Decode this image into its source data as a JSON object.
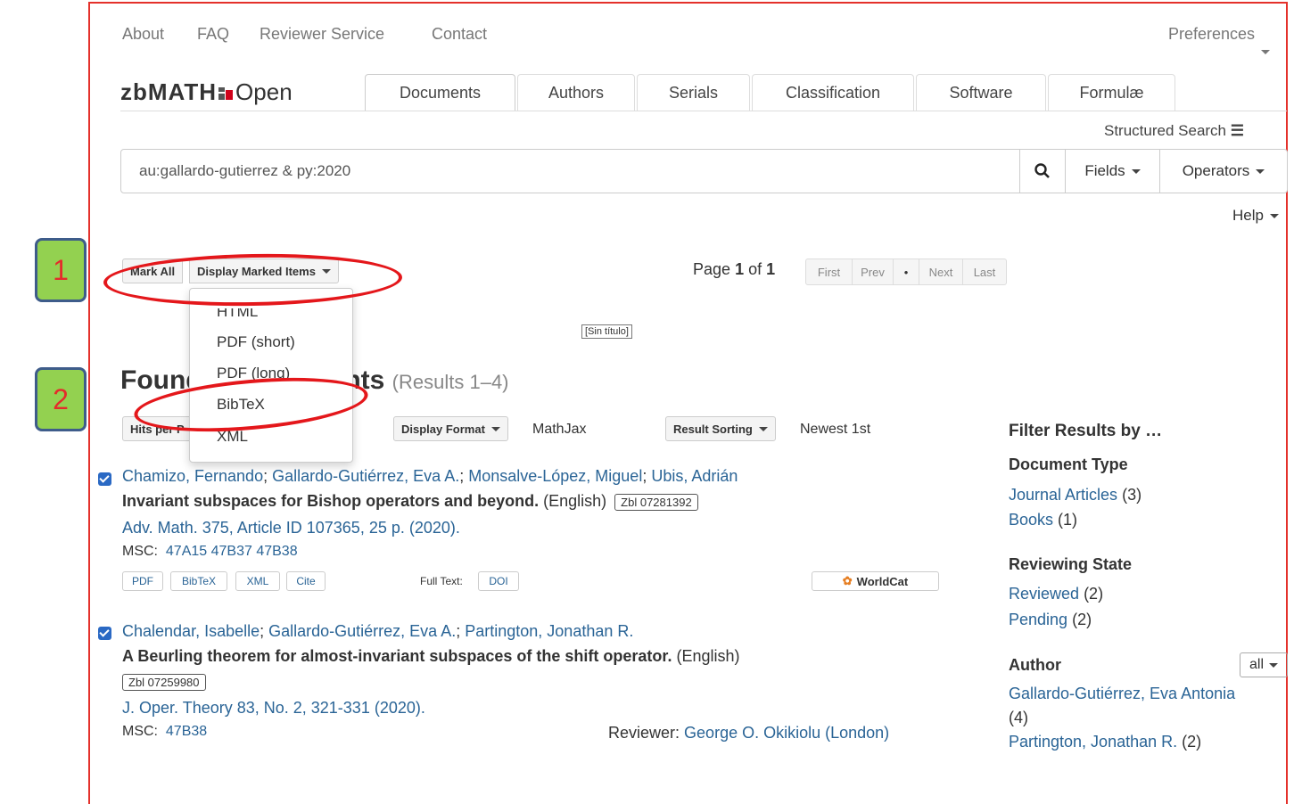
{
  "top_nav": {
    "about": "About",
    "faq": "FAQ",
    "reviewer": "Reviewer Service",
    "contact": "Contact",
    "preferences": "Preferences"
  },
  "logo": {
    "zb": "zbMATH",
    "open": "Open"
  },
  "tabs": [
    "Documents",
    "Authors",
    "Serials",
    "Classification",
    "Software",
    "Formulæ"
  ],
  "structured_search": "Structured Search",
  "search": {
    "value": "au:gallardo-gutierrez & py:2020",
    "fields": "Fields",
    "operators": "Operators"
  },
  "help": "Help",
  "toolbar": {
    "mark_all": "Mark All",
    "display_marked": "Display Marked Items"
  },
  "pager": {
    "page_label": "Page",
    "page": "1",
    "of": "of",
    "total": "1",
    "first": "First",
    "prev": "Prev",
    "dot": "•",
    "next": "Next",
    "last": "Last"
  },
  "tooltip": "[Sin título]",
  "dropdown": [
    "HTML",
    "PDF (short)",
    "PDF (long)",
    "BibTeX",
    "XML"
  ],
  "annotations": {
    "one": "1",
    "two": "2"
  },
  "found": {
    "title_start": "Found",
    "title_end": "ents",
    "results": "(Results 1–4)"
  },
  "controls": {
    "hits_per_page": "Hits per P",
    "display_format": "Display Format",
    "mathjax": "MathJax",
    "result_sorting": "Result Sorting",
    "newest": "Newest 1st"
  },
  "results": [
    {
      "authors": [
        "Chamizo, Fernando",
        "Gallardo-Gutiérrez, Eva A.",
        "Monsalve-López, Miguel",
        "Ubis, Adrián"
      ],
      "title": "Invariant subspaces for Bishop operators and beyond.",
      "lang": "(English)",
      "zbl": "Zbl 07281392",
      "source": "Adv. Math. 375, Article ID 107365, 25 p. (2020).",
      "msc_label": "MSC:",
      "msc": [
        "47A15",
        "47B37",
        "47B38"
      ],
      "buttons": [
        "PDF",
        "BibTeX",
        "XML",
        "Cite"
      ],
      "fulltext_label": "Full Text:",
      "doi": "DOI",
      "worldcat": "WorldCat"
    },
    {
      "authors": [
        "Chalendar, Isabelle",
        "Gallardo-Gutiérrez, Eva A.",
        "Partington, Jonathan R."
      ],
      "title": "A Beurling theorem for almost-invariant subspaces of the shift operator.",
      "lang": "(English)",
      "zbl": "Zbl 07259980",
      "source": "J. Oper. Theory 83, No. 2, 321-331 (2020).",
      "msc_label": "MSC:",
      "msc": [
        "47B38"
      ],
      "reviewer_label": "Reviewer:",
      "reviewer": "George O. Okikiolu (London)"
    }
  ],
  "sidebar": {
    "heading": "Filter Results by …",
    "doc_type": "Document Type",
    "journal": "Journal Articles",
    "journal_count": "(3)",
    "books": "Books",
    "books_count": "(1)",
    "reviewing": "Reviewing State",
    "reviewed": "Reviewed",
    "reviewed_count": "(2)",
    "pending": "Pending",
    "pending_count": "(2)",
    "author": "Author",
    "all": "all",
    "author1": "Gallardo-Gutiérrez, Eva Antonia",
    "author1_count": "(4)",
    "author2": "Partington, Jonathan R.",
    "author2_count": "(2)"
  },
  "colors": {
    "link": "#2a6496",
    "frame": "#e4312b",
    "annotation_green": "#93d150",
    "annotation_red": "#e4171b"
  }
}
